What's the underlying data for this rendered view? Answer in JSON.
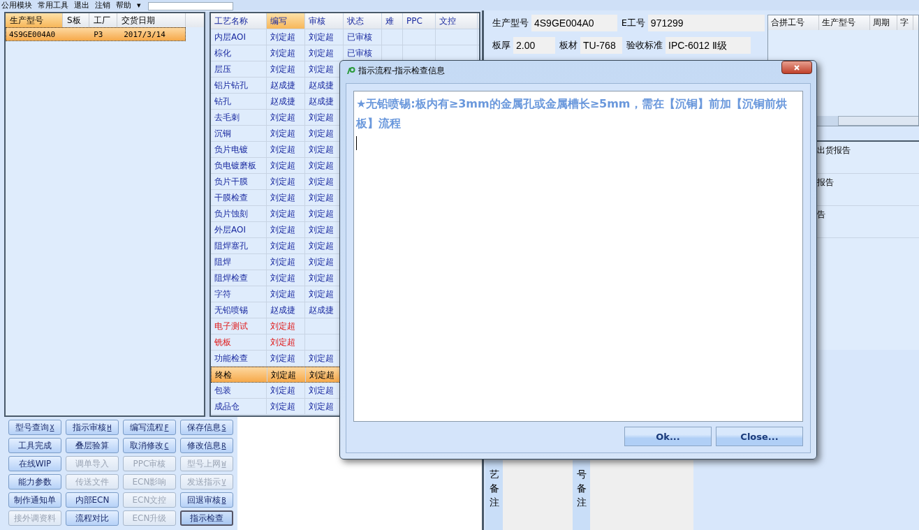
{
  "menu": [
    "公用模块",
    "常用工具",
    "退出",
    "注销",
    "帮助",
    "▾"
  ],
  "orders": {
    "columns": [
      {
        "label": "生产型号",
        "selected": true
      },
      {
        "label": "S板",
        "selected": false
      },
      {
        "label": "工厂",
        "selected": false
      },
      {
        "label": "交货日期",
        "selected": false
      }
    ],
    "rows": [
      {
        "selected": true,
        "cells": [
          "4S9GE004A0",
          "",
          "P3",
          "2017/3/14"
        ]
      }
    ]
  },
  "process": {
    "columns": [
      {
        "label": "工艺名称",
        "selected": false
      },
      {
        "label": "编写",
        "selected": true
      },
      {
        "label": "审核",
        "selected": false
      },
      {
        "label": "状态",
        "selected": false
      },
      {
        "label": "难",
        "selected": false
      },
      {
        "label": "PPC",
        "selected": false
      },
      {
        "label": "文控",
        "selected": false
      }
    ],
    "rows": [
      {
        "name": "内层AOI",
        "writer": "刘定超",
        "reviewer": "刘定超",
        "status": "已审核",
        "flagged": false,
        "selected": false
      },
      {
        "name": "棕化",
        "writer": "刘定超",
        "reviewer": "刘定超",
        "status": "已审核",
        "flagged": false,
        "selected": false
      },
      {
        "name": "层压",
        "writer": "刘定超",
        "reviewer": "刘定超",
        "flagged": false,
        "selected": false
      },
      {
        "name": "铝片钻孔",
        "writer": "赵成捷",
        "reviewer": "赵成捷",
        "flagged": false,
        "selected": false
      },
      {
        "name": "钻孔",
        "writer": "赵成捷",
        "reviewer": "赵成捷",
        "flagged": false,
        "selected": false
      },
      {
        "name": "去毛刺",
        "writer": "刘定超",
        "reviewer": "刘定超",
        "flagged": false,
        "selected": false
      },
      {
        "name": "沉铜",
        "writer": "刘定超",
        "reviewer": "刘定超",
        "flagged": false,
        "selected": false
      },
      {
        "name": "负片电镀",
        "writer": "刘定超",
        "reviewer": "刘定超",
        "flagged": false,
        "selected": false
      },
      {
        "name": "负电镀磨板",
        "writer": "刘定超",
        "reviewer": "刘定超",
        "flagged": false,
        "selected": false
      },
      {
        "name": "负片干膜",
        "writer": "刘定超",
        "reviewer": "刘定超",
        "flagged": false,
        "selected": false
      },
      {
        "name": "干膜检查",
        "writer": "刘定超",
        "reviewer": "刘定超",
        "flagged": false,
        "selected": false
      },
      {
        "name": "负片蚀刻",
        "writer": "刘定超",
        "reviewer": "刘定超",
        "flagged": false,
        "selected": false
      },
      {
        "name": "外层AOI",
        "writer": "刘定超",
        "reviewer": "刘定超",
        "flagged": false,
        "selected": false
      },
      {
        "name": "阻焊塞孔",
        "writer": "刘定超",
        "reviewer": "刘定超",
        "flagged": false,
        "selected": false
      },
      {
        "name": "阻焊",
        "writer": "刘定超",
        "reviewer": "刘定超",
        "flagged": false,
        "selected": false
      },
      {
        "name": "阻焊检查",
        "writer": "刘定超",
        "reviewer": "刘定超",
        "flagged": false,
        "selected": false
      },
      {
        "name": "字符",
        "writer": "刘定超",
        "reviewer": "刘定超",
        "flagged": false,
        "selected": false
      },
      {
        "name": "无铅喷锡",
        "writer": "赵成捷",
        "reviewer": "赵成捷",
        "flagged": false,
        "selected": false
      },
      {
        "name": "电子测试",
        "writer": "刘定超",
        "flagged": true,
        "selected": false
      },
      {
        "name": "铣板",
        "writer": "刘定超",
        "flagged": true,
        "selected": false
      },
      {
        "name": "功能检查",
        "writer": "刘定超",
        "reviewer": "刘定超",
        "flagged": false,
        "selected": false
      },
      {
        "name": "终检",
        "writer": "刘定超",
        "reviewer": "刘定超",
        "flagged": false,
        "selected": true
      },
      {
        "name": "包装",
        "writer": "刘定超",
        "reviewer": "刘定超",
        "flagged": false,
        "selected": false
      },
      {
        "name": "成品仓",
        "writer": "刘定超",
        "reviewer": "刘定超",
        "flagged": false,
        "selected": false
      }
    ]
  },
  "buttons": [
    {
      "label": "型号查询",
      "hotkey": "X",
      "disabled": false,
      "pressed": false
    },
    {
      "label": "指示审核",
      "hotkey": "H",
      "disabled": false,
      "pressed": false
    },
    {
      "label": "编写流程",
      "hotkey": "F",
      "disabled": false,
      "pressed": false
    },
    {
      "label": "保存信息",
      "hotkey": "S",
      "disabled": false,
      "pressed": false
    },
    {
      "label": "工具完成",
      "disabled": false,
      "pressed": false
    },
    {
      "label": "叠层验算",
      "disabled": false,
      "pressed": false
    },
    {
      "label": "取消修改",
      "hotkey": "C",
      "disabled": false,
      "pressed": false
    },
    {
      "label": "修改信息",
      "hotkey": "R",
      "disabled": false,
      "pressed": false
    },
    {
      "label": "在线WIP",
      "disabled": false,
      "pressed": false
    },
    {
      "label": "调单导入",
      "disabled": true,
      "pressed": false
    },
    {
      "label": "PPC审核",
      "disabled": true,
      "pressed": false
    },
    {
      "label": "型号上网",
      "hotkey": "W",
      "disabled": true,
      "pressed": false
    },
    {
      "label": "能力参数",
      "disabled": false,
      "pressed": false
    },
    {
      "label": "传送文件",
      "disabled": true,
      "pressed": false
    },
    {
      "label": "ECN影响",
      "disabled": true,
      "pressed": false
    },
    {
      "label": "发送指示",
      "hotkey": "V",
      "disabled": true,
      "pressed": false
    },
    {
      "label": "制作通知单",
      "disabled": false,
      "pressed": false
    },
    {
      "label": "内部ECN",
      "disabled": false,
      "pressed": false
    },
    {
      "label": "ECN文控",
      "disabled": true,
      "pressed": false
    },
    {
      "label": "回退审核",
      "hotkey": "B",
      "disabled": false,
      "pressed": false
    },
    {
      "label": "接外调资料",
      "disabled": true,
      "pressed": false
    },
    {
      "label": "流程对比",
      "disabled": false,
      "pressed": false
    },
    {
      "label": "ECN升级",
      "disabled": true,
      "pressed": false
    },
    {
      "label": "指示检查",
      "disabled": false,
      "pressed": true
    }
  ],
  "info": {
    "fields": [
      [
        {
          "label": "生产型号",
          "value": "4S9GE004A0"
        },
        {
          "label": "E工号",
          "value": "971299"
        }
      ],
      [
        {
          "label": "板厚",
          "value": "2.00"
        },
        {
          "label": "板材",
          "value": "TU-768"
        },
        {
          "label": "验收标准",
          "value": "IPC-6012 Ⅱ级"
        }
      ]
    ],
    "merge_columns": [
      "合拼工号",
      "生产型号",
      "周期",
      "字"
    ],
    "reports": [
      "出货报告",
      "报告",
      "告"
    ],
    "remarks": [
      "艺备注",
      "号备注"
    ]
  },
  "dialog": {
    "title": "指示流程-指示检查信息",
    "message": "★无铅喷锡:板内有≥3mm的金属孔或金属槽长≥5mm，需在【沉铜】前加【沉铜前烘板】流程",
    "buttons": [
      "Ok...",
      "Close..."
    ]
  }
}
